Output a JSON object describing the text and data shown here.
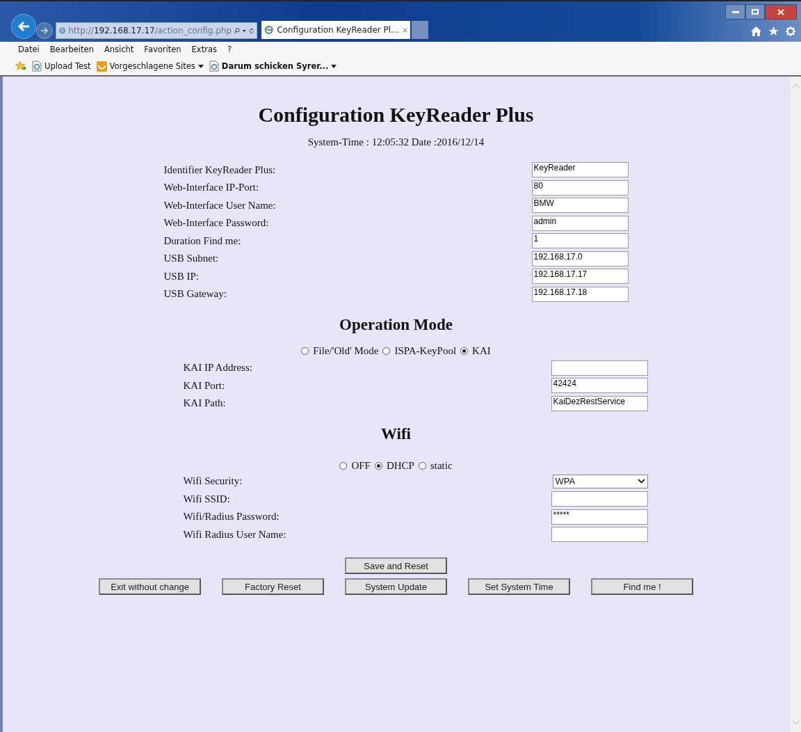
{
  "browser": {
    "address": "http://**192.168.17.17**/action_config.php",
    "tab_title": "Configuration KeyReader Pl...",
    "menu": [
      "Datei",
      "Bearbeiten",
      "Ansicht",
      "Favoriten",
      "Extras",
      "?"
    ],
    "favorites": [
      {
        "label": "Upload Test",
        "kind": "page",
        "dropdown": false
      },
      {
        "label": "Vorgeschlagene Sites",
        "kind": "suggested",
        "dropdown": true
      },
      {
        "label": "Darum schicken Syrer...",
        "kind": "page",
        "dropdown": true,
        "bold": true
      }
    ]
  },
  "page": {
    "title": "Configuration KeyReader Plus",
    "system_time": "System-Time : 12:05:32 Date :2016/12/14",
    "general_fields": [
      {
        "label": "Identifier KeyReader Plus:",
        "kind": "text",
        "value": "KeyReader"
      },
      {
        "label": "Web-Interface IP-Port:",
        "kind": "text",
        "value": "80"
      },
      {
        "label": "Web-Interface User Name:",
        "kind": "text",
        "value": "BMW"
      },
      {
        "label": "Web-Interface Password:",
        "kind": "text",
        "value": "admin"
      },
      {
        "label": "Duration Find me:",
        "kind": "text",
        "value": "1"
      },
      {
        "label": "USB Subnet:",
        "kind": "text",
        "value": "192.168.17.0"
      },
      {
        "label": "USB IP:",
        "kind": "text",
        "value": "192.168.17.17"
      },
      {
        "label": "USB Gateway:",
        "kind": "text",
        "value": "192.168.17.18"
      }
    ],
    "operation_mode": {
      "heading": "Operation Mode",
      "options": [
        {
          "label": "File/'Old' Mode",
          "selected": false
        },
        {
          "label": "ISPA-KeyPool",
          "selected": false
        },
        {
          "label": "KAI",
          "selected": true
        }
      ],
      "fields": [
        {
          "label": "KAI IP Address:",
          "kind": "text"
        },
        {
          "label": "KAI Port:",
          "kind": "text",
          "value": "42424"
        },
        {
          "label": "KAI Path:",
          "kind": "text",
          "value": "KaiDezRestService"
        }
      ]
    },
    "wifi": {
      "heading": "Wifi",
      "options": [
        {
          "label": "OFF",
          "selected": false
        },
        {
          "label": "DHCP",
          "selected": true
        },
        {
          "label": "static",
          "selected": false
        }
      ],
      "fields": [
        {
          "label": "Wifi Security:",
          "kind": "select",
          "value": "WPA"
        },
        {
          "label": "Wifi SSID:",
          "kind": "text"
        },
        {
          "label": "Wifi/Radius Password:",
          "kind": "text",
          "value": "*****"
        },
        {
          "label": "Wifi Radius User Name:",
          "kind": "text"
        }
      ]
    },
    "top_button": "Save and Reset",
    "buttons": [
      "Exit without change",
      "Factory Reset",
      "System Update",
      "Set System Time",
      "Find me !"
    ]
  }
}
